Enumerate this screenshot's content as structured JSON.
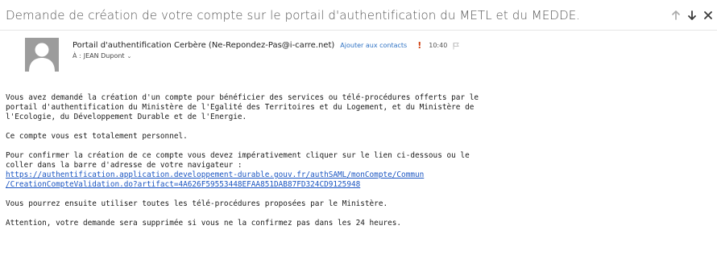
{
  "subject": "Demande de création de votre compte sur le portail d'authentification du METL et du MEDDE.",
  "nav": {
    "up_icon": "arrow-up-icon",
    "down_icon": "arrow-down-icon",
    "close_icon": "close-icon"
  },
  "header": {
    "sender": "Portail d'authentification Cerbère (Ne-Repondez-Pas@i-carre.net)",
    "add_contact": "Ajouter aux contacts",
    "importance": "!",
    "time": "10:40",
    "to_prefix": "À :",
    "to_name": "JEAN Dupont",
    "chevron": "⌄"
  },
  "body": {
    "p1_l1": "Vous avez demandé la création d'un compte pour bénéficier des services ou télé-procédures offerts par le",
    "p1_l2": "portail d'authentification du Ministère de l'Egalité des Territoires et du Logement, et du Ministère de",
    "p1_l3": "l'Ecologie, du Développement Durable et de l'Energie.",
    "p2": "Ce compte vous est totalement personnel.",
    "p3_l1": "Pour confirmer la création de ce compte vous devez impérativement cliquer sur le lien ci-dessous ou le",
    "p3_l2": "coller dans la barre d'adresse de votre navigateur :",
    "link_l1": "https://authentification.application.developpement-durable.gouv.fr/authSAML/monCompte/Commun",
    "link_l2": "/CreationCompteValidation.do?artifact=4A626F59553448EFAA851DAB87FD324CD9125948",
    "p4": "Vous pourrez ensuite utiliser toutes les télé-procédures proposées par le Ministère.",
    "p5": "Attention, votre demande sera supprimée si vous ne la confirmez pas dans les 24 heures."
  },
  "colors": {
    "link": "#1a55c2",
    "accent": "#2f73c4",
    "importance": "#d04010",
    "avatar": "#9c9c9c"
  }
}
